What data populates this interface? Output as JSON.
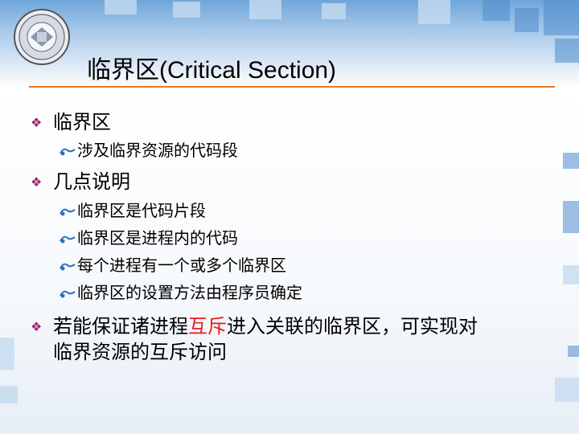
{
  "title": {
    "cn": "临界区",
    "latin": "(Critical Section)"
  },
  "logo": {
    "name": "university-seal"
  },
  "colors": {
    "rule": "#e8772c",
    "bullet": "#a0236e",
    "highlight": "#e8201c",
    "sub_bullet": "#2f6fbf"
  },
  "items": [
    {
      "level": 1,
      "text": "临界区"
    },
    {
      "level": 2,
      "text": "涉及临界资源的代码段"
    },
    {
      "level": 1,
      "text": "几点说明"
    },
    {
      "level": 2,
      "text": "临界区是代码片段"
    },
    {
      "level": 2,
      "text": "临界区是进程内的代码"
    },
    {
      "level": 2,
      "text": "每个进程有一个或多个临界区"
    },
    {
      "level": 2,
      "text": "临界区的设置方法由程序员确定"
    },
    {
      "level": 1,
      "text_before": "若能保证诸进程",
      "text_highlight": "互斥",
      "text_after": "进入关联的临界区，可实现对",
      "text_line2": "临界资源的互斥访问"
    }
  ]
}
